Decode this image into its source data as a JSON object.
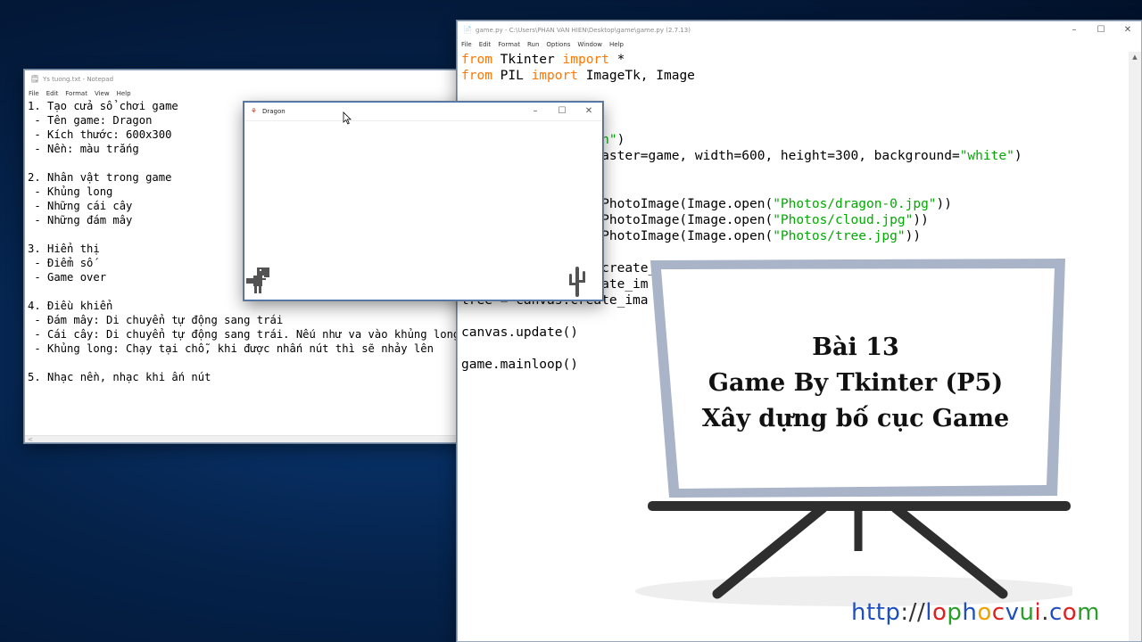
{
  "notepad": {
    "title": "Ys tuong.txt - Notepad",
    "menu": [
      "File",
      "Edit",
      "Format",
      "View",
      "Help"
    ],
    "lines": [
      "1. Tạo cửa sổ chơi game",
      " - Tên game: Dragon",
      " - Kích thước: 600x300",
      " - Nền: màu trắng",
      "",
      "2. Nhân vật trong game",
      " - Khủng long",
      " - Những cái cây",
      " - Những đám mây",
      "",
      "3. Hiển thị",
      " - Điểm số",
      " - Game over",
      "",
      "4. Điều khiển",
      " - Đám mây: Di chuyển tự động sang trái",
      " - Cái cây: Di chuyển tự động sang trái. Nếu như va vào khủng long",
      " - Khủng long: Chạy tại chỗ, khi được nhấn nút thì sẽ nhảy lên",
      "",
      "5. Nhạc nền, nhạc khi ấn nút"
    ]
  },
  "idle": {
    "title": "game.py - C:\\Users\\PHAN VAN HIEN\\Desktop\\game\\game.py (2.7.13)",
    "menu": [
      "File",
      "Edit",
      "Format",
      "Run",
      "Options",
      "Window",
      "Help"
    ],
    "code": [
      [
        {
          "t": "from",
          "c": "kw"
        },
        {
          "t": " Tkinter "
        },
        {
          "t": "import",
          "c": "kw"
        },
        {
          "t": " *"
        }
      ],
      [
        {
          "t": "from",
          "c": "kw"
        },
        {
          "t": " PIL "
        },
        {
          "t": "import",
          "c": "kw"
        },
        {
          "t": " ImageTk, Image"
        }
      ],
      [],
      [],
      [],
      [
        {
          "t": "                  "
        },
        {
          "t": "n\"",
          "c": "str"
        },
        {
          "t": ")"
        }
      ],
      [
        {
          "t": "                  aster=game, width=600, height=300, background="
        },
        {
          "t": "\"white\"",
          "c": "str"
        },
        {
          "t": ")"
        }
      ],
      [],
      [],
      [
        {
          "t": "                  PhotoImage(Image.open("
        },
        {
          "t": "\"Photos/dragon-0.jpg\"",
          "c": "str"
        },
        {
          "t": "))"
        }
      ],
      [
        {
          "t": "                  PhotoImage(Image.open("
        },
        {
          "t": "\"Photos/cloud.jpg\"",
          "c": "str"
        },
        {
          "t": "))"
        }
      ],
      [
        {
          "t": "                  PhotoImage(Image.open("
        },
        {
          "t": "\"Photos/tree.jpg\"",
          "c": "str"
        },
        {
          "t": "))"
        }
      ],
      [],
      [
        {
          "t": "                  create_"
        }
      ],
      [
        {
          "t": "cloud = canvas.create_im"
        }
      ],
      [
        {
          "t": "tree = canvas.create_ima"
        }
      ],
      [],
      [
        {
          "t": "canvas.update()"
        }
      ],
      [],
      [
        {
          "t": "game.mainloop()"
        }
      ]
    ]
  },
  "dragon_window": {
    "title": "Dragon",
    "icon": "tk-feather-icon"
  },
  "board": {
    "line1": "Bài 13",
    "line2": "Game By Tkinter (P5)",
    "line3": "Xây dựng bố cục Game"
  },
  "url": {
    "chars": [
      {
        "ch": "h",
        "color": "#1f4fbf"
      },
      {
        "ch": "t",
        "color": "#1f4fbf"
      },
      {
        "ch": "t",
        "color": "#1f4fbf"
      },
      {
        "ch": "p",
        "color": "#1f4fbf"
      },
      {
        "ch": ":",
        "color": "#333333"
      },
      {
        "ch": "/",
        "color": "#333333"
      },
      {
        "ch": "/",
        "color": "#333333"
      },
      {
        "ch": "l",
        "color": "#1f4fbf"
      },
      {
        "ch": "o",
        "color": "#e02020"
      },
      {
        "ch": "p",
        "color": "#2a9d2a"
      },
      {
        "ch": "h",
        "color": "#1f4fbf"
      },
      {
        "ch": "o",
        "color": "#f0a000"
      },
      {
        "ch": "c",
        "color": "#e02020"
      },
      {
        "ch": "v",
        "color": "#1f4fbf"
      },
      {
        "ch": "u",
        "color": "#2a9d2a"
      },
      {
        "ch": "i",
        "color": "#e02020"
      },
      {
        "ch": ".",
        "color": "#333333"
      },
      {
        "ch": "c",
        "color": "#1f4fbf"
      },
      {
        "ch": "o",
        "color": "#e02020"
      },
      {
        "ch": "m",
        "color": "#2a9d2a"
      }
    ]
  },
  "colors": {
    "keyword": "#ff7700",
    "string": "#00aa00",
    "board_frame": "#a9b4c8"
  }
}
